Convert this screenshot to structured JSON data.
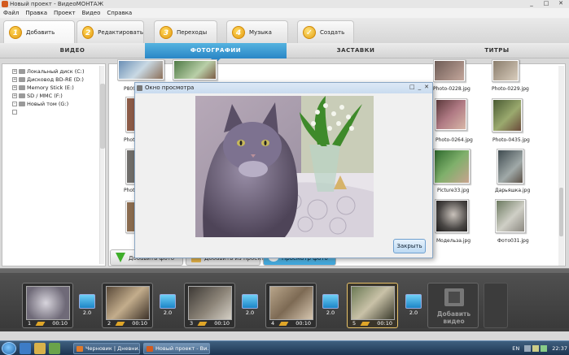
{
  "window": {
    "title": "Новый проект - ВидеоМОНТАЖ",
    "controls": [
      "_",
      "□",
      "✕"
    ]
  },
  "menu": [
    "Файл",
    "Правка",
    "Проект",
    "Видео",
    "Справка"
  ],
  "steps": [
    {
      "num": "1",
      "label": "Добавить"
    },
    {
      "num": "2",
      "label": "Редактировать"
    },
    {
      "num": "3",
      "label": "Переходы"
    },
    {
      "num": "4",
      "label": "Музыка"
    },
    {
      "num": "✓",
      "label": "Создать"
    }
  ],
  "subtabs": [
    "ВИДЕО",
    "ФОТОГРАФИИ",
    "ЗАСТАВКИ",
    "ТИТРЫ"
  ],
  "tree": [
    {
      "sign": "+",
      "label": "Локальный диск (C:)"
    },
    {
      "sign": "+",
      "label": "Дисковод BD-RE (D:)"
    },
    {
      "sign": "+",
      "label": "Memory Stick (E:)"
    },
    {
      "sign": "+",
      "label": "SD / MMC (F:)"
    },
    {
      "sign": "-",
      "label": "Новый том (G:)"
    }
  ],
  "photos": {
    "row0": [
      "P809",
      "",
      "",
      "",
      "",
      "Photo-0228.jpg",
      "Photo-0229.jpg"
    ],
    "row1": [
      "Photo",
      "Photo-0264.jpg",
      "Photo-0435.jpg"
    ],
    "row2": [
      "Photo",
      "Picture33.jpg",
      "Дарьяшка.jpg"
    ],
    "row3": [
      "Модельза.jpg",
      "Фото031.jpg"
    ]
  },
  "buttons": {
    "add_photo": "Добавить фото",
    "add_folder": "Добавить из проекта",
    "preview": "Просмотр фото"
  },
  "preview": {
    "title": "Окно просмотра",
    "close": "Закрыть",
    "controls": [
      "□",
      "_",
      "✕"
    ]
  },
  "timeline": {
    "slots": [
      {
        "n": "1",
        "dur": "00:10"
      },
      {
        "n": "2",
        "dur": "00:10"
      },
      {
        "n": "3",
        "dur": "00:10"
      },
      {
        "n": "4",
        "dur": "00:10"
      },
      {
        "n": "5",
        "dur": "00:10"
      }
    ],
    "transitions": [
      "2.0",
      "2.0",
      "2.0",
      "2.0",
      "2.0"
    ],
    "add_video": "Добавить видео"
  },
  "taskbar": {
    "tasks": [
      "Черновик | Дневни...",
      "Новый проект - Ви..."
    ],
    "lang": "EN",
    "time": "22:37"
  },
  "colors": {
    "accent": "#2a86c6",
    "orange": "#e39a12",
    "timeline": "#3d3d3d"
  }
}
